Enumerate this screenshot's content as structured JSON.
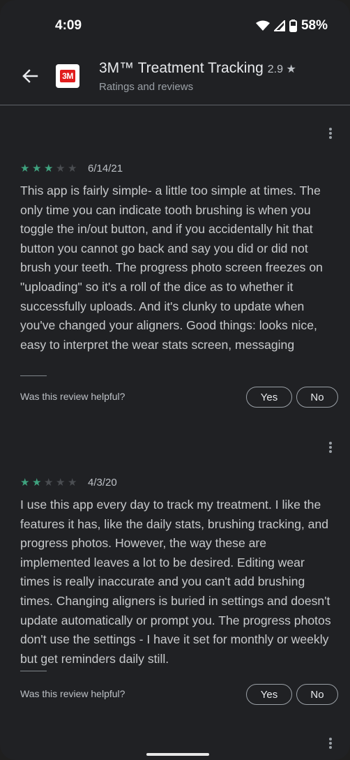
{
  "status": {
    "time": "4:09",
    "battery": "58%"
  },
  "app": {
    "title": "3M™ Treatment Tracking",
    "rating": "2.9",
    "star": "★",
    "subtitle": "Ratings and reviews",
    "logo_text": "3M"
  },
  "reviews": [
    {
      "rating": 3,
      "date": "6/14/21",
      "text": "This app is fairly simple- a little too simple at times. The only time you can indicate tooth brushing is when you toggle the in/out button, and if you accidentally hit that button you cannot go back and say you did or did not brush your teeth. The progress photo screen freezes on \"uploading\" so it's a roll of the dice as to whether it successfully uploads. And it's clunky to update when you've changed your aligners. Good things: looks nice, easy to interpret the wear stats screen, messaging",
      "helpful_prompt": "Was this review helpful?",
      "yes_label": "Yes",
      "no_label": "No"
    },
    {
      "rating": 2,
      "date": "4/3/20",
      "text": "I use this app every day to track my treatment. I like the features it has, like the daily stats, brushing tracking, and progress photos. However, the way these are implemented leaves a lot to be desired. Editing wear times is really inaccurate and you can't add brushing times. Changing aligners is buried in settings and doesn't update automatically or prompt you. The progress photos don't use the settings - I have it set for monthly or weekly but get reminders daily still.",
      "helpful_prompt": "Was this review helpful?",
      "yes_label": "Yes",
      "no_label": "No"
    }
  ],
  "colors": {
    "star_filled": "#3fa37f",
    "star_empty": "#4a4d51"
  }
}
